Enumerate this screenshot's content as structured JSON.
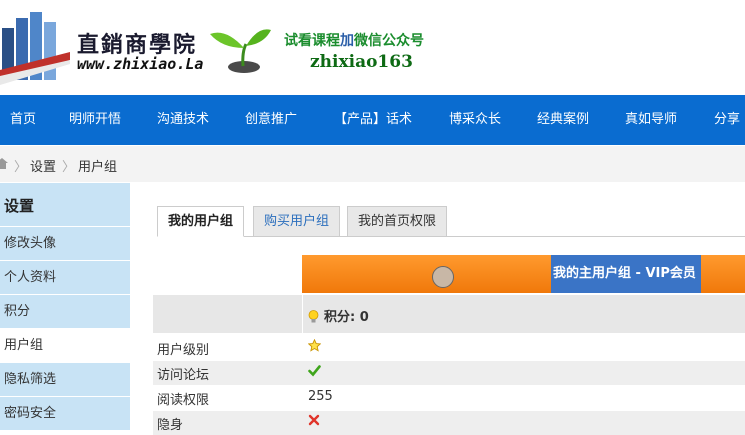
{
  "logo": {
    "title_cn": "直銷商學院",
    "url_text": "www.zhixiao.La"
  },
  "promo": {
    "line1_a": "试看课程",
    "line1_b": "加",
    "line1_c": "微信公众号",
    "line2": "zhixiao163"
  },
  "nav": {
    "items": [
      "首页",
      "明师开悟",
      "沟通技术",
      "创意推广",
      "【产品】话术",
      "博采众长",
      "经典案例",
      "真如导师",
      "分享"
    ]
  },
  "breadcrumb": {
    "items": [
      "设置",
      "用户组"
    ]
  },
  "sidebar": {
    "title": "设置",
    "items": [
      "修改头像",
      "个人资料",
      "积分",
      "用户组",
      "隐私筛选",
      "密码安全"
    ],
    "active_index": 3
  },
  "tabs": {
    "items": [
      "我的用户组",
      "购买用户组",
      "我的首页权限"
    ],
    "active_index": 0
  },
  "usergroup": {
    "banner": "我的主用户组 - VIP会员",
    "points_label": "积分: 0"
  },
  "permissions": [
    {
      "label": "用户级别",
      "value": "",
      "icon": "star-icon"
    },
    {
      "label": "访问论坛",
      "value": "",
      "icon": "check-icon"
    },
    {
      "label": "阅读权限",
      "value": "255",
      "icon": ""
    },
    {
      "label": "隐身",
      "value": "",
      "icon": "cross-icon"
    }
  ],
  "colors": {
    "nav_bg": "#0a6cd0",
    "sidebar_bg": "#c8e3f5",
    "banner_orange": "#f0780a",
    "banner_blue": "#3a74c6"
  }
}
